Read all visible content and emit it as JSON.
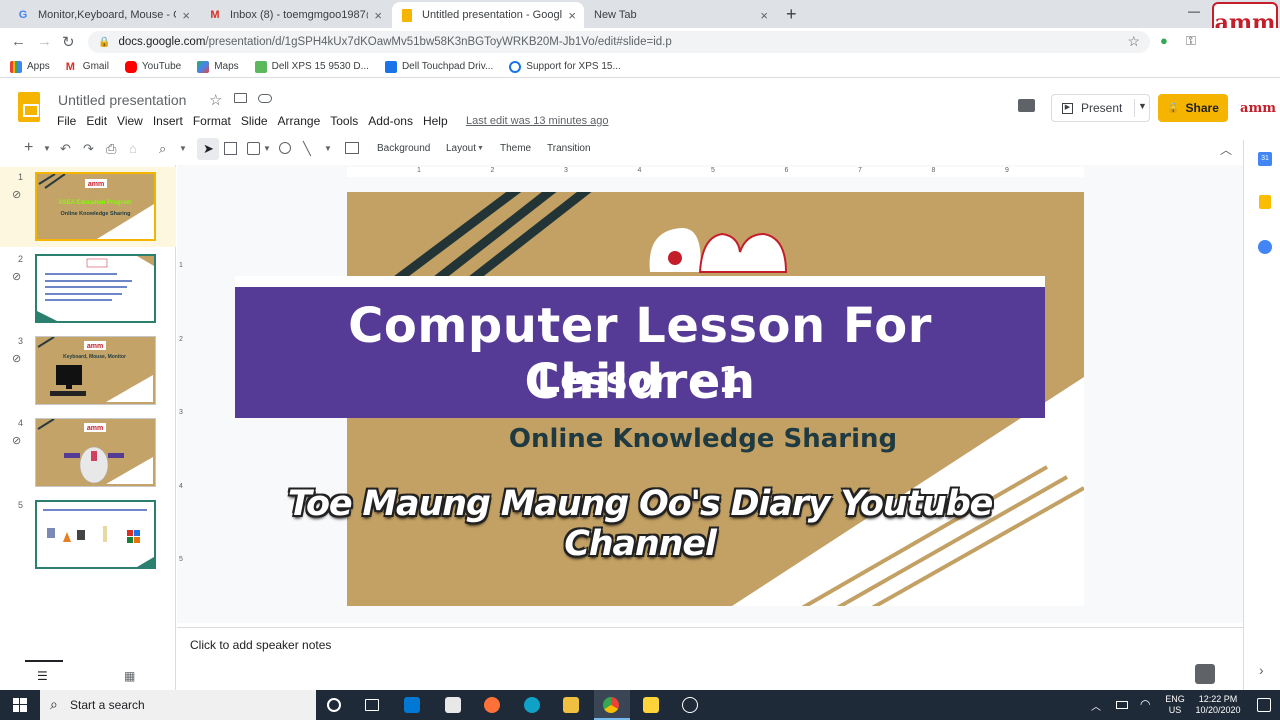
{
  "browser": {
    "tabs": [
      {
        "title": "Monitor,Keyboard, Mouse - Goo",
        "icon": "google-icon"
      },
      {
        "title": "Inbox (8) - toemgmgoo1987@gr",
        "icon": "gmail-icon"
      },
      {
        "title": "Untitled presentation - Google S",
        "icon": "slides-icon"
      },
      {
        "title": "New Tab",
        "icon": "none"
      }
    ],
    "url_domain": "docs.google.com",
    "url_path": "/presentation/d/1gSPH4kUx7dKOawMv51bw58K3nBGToyWRKB20M-Jb1Vo/edit#slide=id.p",
    "bookmarks": [
      "Apps",
      "Gmail",
      "YouTube",
      "Maps",
      "Dell XPS 15 9530 D...",
      "Dell Touchpad Driv...",
      "Support for XPS 15..."
    ]
  },
  "app": {
    "title": "Untitled presentation",
    "menus": [
      "File",
      "Edit",
      "View",
      "Insert",
      "Format",
      "Slide",
      "Arrange",
      "Tools",
      "Add-ons",
      "Help"
    ],
    "last_edit": "Last edit was 13 minutes ago",
    "present": "Present",
    "share": "Share"
  },
  "toolbar": {
    "background": "Background",
    "layout": "Layout",
    "theme": "Theme",
    "transition": "Transition"
  },
  "ruler": {
    "marks": [
      "1",
      "2",
      "3",
      "4",
      "5",
      "6",
      "7",
      "8",
      "9"
    ],
    "vmarks": [
      "1",
      "2",
      "3",
      "4",
      "5"
    ]
  },
  "slides": {
    "numbers": [
      "1",
      "2",
      "3",
      "4",
      "5"
    ],
    "selected": "1"
  },
  "thumbs": {
    "s1_title": "Online Knowledge Sharing",
    "s3_title": "Keyboard, Mouse, Monitor"
  },
  "slide": {
    "logo": "amm",
    "title1": "Computer Lesson For Children",
    "title2": "Lesson - 1",
    "subtitle": "Online Knowledge Sharing",
    "caption": "Toe Maung Maung Oo's Diary Youtube Channel"
  },
  "notes": {
    "placeholder": "Click to add speaker notes"
  },
  "taskbar": {
    "search": "Start a search",
    "lang1": "ENG",
    "lang2": "US",
    "time": "12:22 PM",
    "date": "10/20/2020"
  },
  "colors": {
    "slide_bg": "#c3a165",
    "banner": "#553a96",
    "accent": "#f4b400"
  }
}
